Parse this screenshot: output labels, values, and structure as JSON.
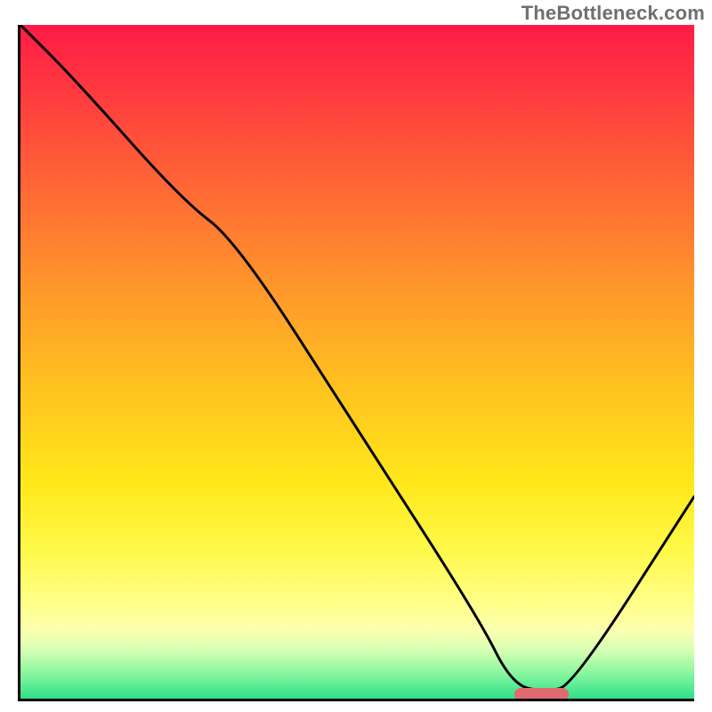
{
  "watermark": "TheBottleneck.com",
  "chart_data": {
    "type": "line",
    "title": "",
    "xlabel": "",
    "ylabel": "",
    "xlim": [
      0,
      100
    ],
    "ylim": [
      0,
      100
    ],
    "grid": false,
    "series": [
      {
        "name": "bottleneck-curve",
        "x": [
          0,
          8,
          24,
          32,
          50,
          68,
          73,
          78,
          82,
          100
        ],
        "values": [
          100,
          92,
          74,
          68,
          40,
          12,
          2,
          1,
          2,
          30
        ]
      }
    ],
    "annotations": [
      {
        "type": "marker",
        "name": "optimal-range",
        "x_start": 73,
        "x_end": 81,
        "y": 1,
        "color": "#e16a6f"
      }
    ],
    "background_gradient": {
      "top": "#ff1a47",
      "mid": "#ffe81a",
      "bottom": "#2ee08a"
    }
  }
}
